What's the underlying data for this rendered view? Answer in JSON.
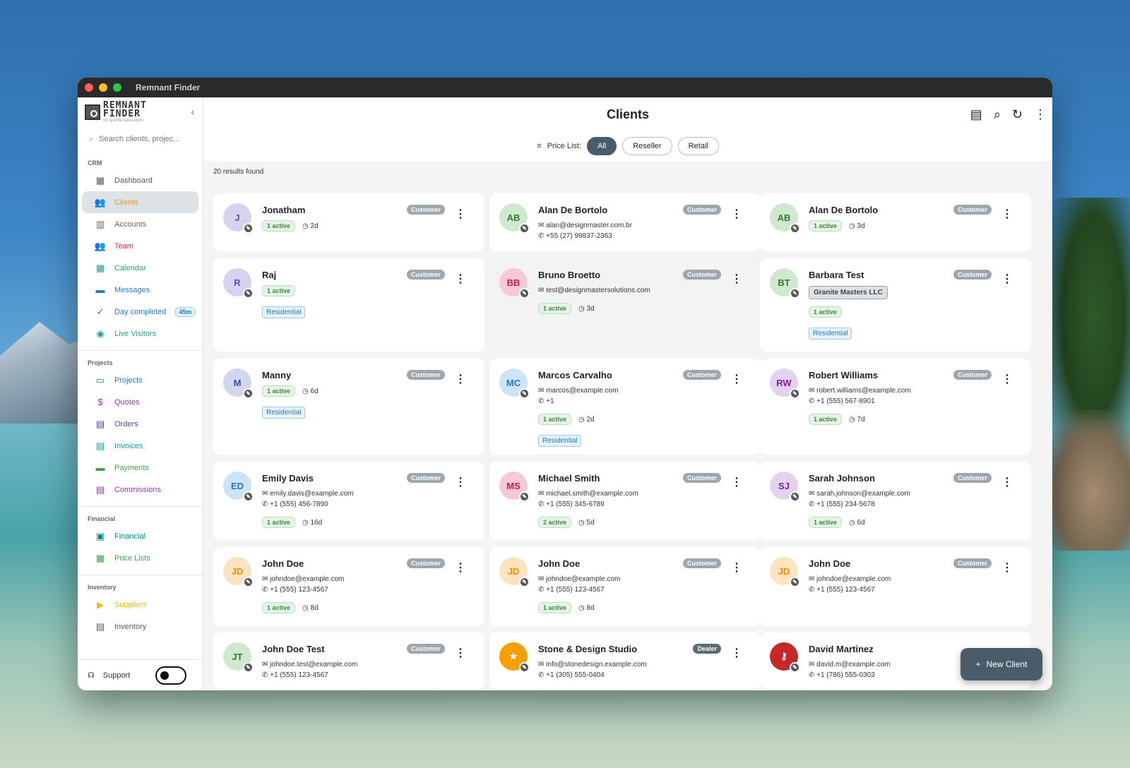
{
  "window": {
    "title": "Remnant Finder"
  },
  "sidebar": {
    "logo_line1": "REMNANT",
    "logo_line2": "FINDER",
    "logo_sub": "for granite fabricators",
    "search_placeholder": "Search clients, projec...",
    "sections": [
      {
        "label": "CRM",
        "items": [
          {
            "label": "Dashboard",
            "icon": "dashboard-icon",
            "color": "#4a5c6a",
            "active": false
          },
          {
            "label": "Clients",
            "icon": "people-icon",
            "color": "#f39c12",
            "active": true
          },
          {
            "label": "Accounts",
            "icon": "building-icon",
            "color": "#8d5a3b",
            "active": false
          },
          {
            "label": "Team",
            "icon": "team-icon",
            "color": "#e0245e",
            "active": false
          },
          {
            "label": "Calendar",
            "icon": "calendar-icon",
            "color": "#1aa38a",
            "active": false
          },
          {
            "label": "Messages",
            "icon": "message-icon",
            "color": "#1f7ac2",
            "active": false
          },
          {
            "label": "Day completed",
            "icon": "check-circle-icon",
            "color": "#1f7ac2",
            "active": false,
            "badge": "45m"
          },
          {
            "label": "Live Visitors",
            "icon": "visitors-icon",
            "color": "#1aa38a",
            "active": false
          }
        ]
      },
      {
        "label": "Projects",
        "items": [
          {
            "label": "Projects",
            "icon": "folder-icon",
            "color": "#1f7ac2"
          },
          {
            "label": "Quotes",
            "icon": "quote-icon",
            "color": "#9b30a8"
          },
          {
            "label": "Orders",
            "icon": "order-icon",
            "color": "#3949ab"
          },
          {
            "label": "Invoices",
            "icon": "invoice-icon",
            "color": "#00a3b4"
          },
          {
            "label": "Payments",
            "icon": "payment-icon",
            "color": "#43a047"
          },
          {
            "label": "Commissions",
            "icon": "commission-icon",
            "color": "#9b30a8"
          }
        ]
      },
      {
        "label": "Financial",
        "items": [
          {
            "label": "Financial",
            "icon": "financial-icon",
            "color": "#00897b"
          },
          {
            "label": "Price Lists",
            "icon": "pricelist-icon",
            "color": "#43a047"
          }
        ]
      },
      {
        "label": "Inventory",
        "items": [
          {
            "label": "Suppliers",
            "icon": "truck-icon",
            "color": "#f5b800"
          },
          {
            "label": "Inventory",
            "icon": "inventory-icon",
            "color": "#4a5c6a"
          }
        ]
      }
    ],
    "support_label": "Support"
  },
  "header": {
    "title": "Clients"
  },
  "filter": {
    "label": "Price List:",
    "chips": [
      "All",
      "Reseller",
      "Retail"
    ],
    "selected": "All"
  },
  "results": "20 results found",
  "fab_label": "New Client",
  "colors": {
    "primary": "#4a5c6a",
    "active_green": "#3a8a3e",
    "residential_blue": "#1f7ac2"
  },
  "cards": [
    {
      "name": "Jonatham",
      "initials": "J",
      "av_bg": "#d8d2ee",
      "av_fg": "#5b4fb3",
      "tag": "Customer",
      "active": "1 active",
      "time": "2d",
      "residential": false
    },
    {
      "name": "Alan De Bortolo",
      "initials": "AB",
      "av_bg": "#cfe8cf",
      "av_fg": "#2e7d32",
      "tag": "Customer",
      "email": "alan@designmaster.com.br",
      "phone": "+55 (27) 99837-2363"
    },
    {
      "name": "Alan De Bortolo",
      "initials": "AB",
      "av_bg": "#cfe8cf",
      "av_fg": "#2e7d32",
      "tag": "Customer",
      "active": "1 active",
      "time": "3d"
    },
    {
      "name": "Raj",
      "initials": "R",
      "av_bg": "#d8d2ee",
      "av_fg": "#5b4fb3",
      "tag": "Customer",
      "active": "1 active",
      "residential": "Residential"
    },
    {
      "name": "Bruno Broetto",
      "initials": "BB",
      "av_bg": "#f7c9d6",
      "av_fg": "#c2185b",
      "tag": "Customer",
      "email": "test@designmastersolutions.com",
      "active": "1 active",
      "time": "3d",
      "dim": true
    },
    {
      "name": "Barbara Test",
      "initials": "BT",
      "av_bg": "#cfe8cf",
      "av_fg": "#2e7d32",
      "tag": "Customer",
      "company": "Granite Masters LLC",
      "active": "1 active",
      "residential": "Residential"
    },
    {
      "name": "Manny",
      "initials": "M",
      "av_bg": "#d2d6ee",
      "av_fg": "#3949ab",
      "tag": "Customer",
      "active": "1 active",
      "time": "6d",
      "residential": "Residential"
    },
    {
      "name": "Marcos Carvalho",
      "initials": "MC",
      "av_bg": "#cde4f7",
      "av_fg": "#1f7ac2",
      "tag": "Customer",
      "email": "marcos@example.com",
      "phone": "+1",
      "active": "1 active",
      "time": "2d",
      "residential": "Residential"
    },
    {
      "name": "Robert Williams",
      "initials": "RW",
      "av_bg": "#e3d2ee",
      "av_fg": "#7b1fa2",
      "tag": "Customer",
      "email": "robert.williams@example.com",
      "phone": "+1 (555) 567-8901",
      "active": "1 active",
      "time": "7d"
    },
    {
      "name": "Emily Davis",
      "initials": "ED",
      "av_bg": "#cde4f7",
      "av_fg": "#1f7ac2",
      "tag": "Customer",
      "email": "emily.davis@example.com",
      "phone": "+1 (555) 456-7890",
      "active": "1 active",
      "time": "16d"
    },
    {
      "name": "Michael Smith",
      "initials": "MS",
      "av_bg": "#f7c9d6",
      "av_fg": "#c2185b",
      "tag": "Customer",
      "email": "michael.smith@example.com",
      "phone": "+1 (555) 345-6789",
      "active": "2 active",
      "time": "5d"
    },
    {
      "name": "Sarah Johnson",
      "initials": "SJ",
      "av_bg": "#e3d2ee",
      "av_fg": "#7b1fa2",
      "tag": "Customer",
      "email": "sarah.johnson@example.com",
      "phone": "+1 (555) 234-5678",
      "active": "1 active",
      "time": "6d"
    },
    {
      "name": "John Doe",
      "initials": "JD",
      "av_bg": "#fde3bf",
      "av_fg": "#ef8f00",
      "tag": "Customer",
      "email": "johndoe@example.com",
      "phone": "+1 (555) 123-4567",
      "active": "1 active",
      "time": "8d"
    },
    {
      "name": "John Doe",
      "initials": "JD",
      "av_bg": "#fde3bf",
      "av_fg": "#ef8f00",
      "tag": "Customer",
      "email": "johndoe@example.com",
      "phone": "+1 (555) 123-4567",
      "active": "1 active",
      "time": "8d"
    },
    {
      "name": "John Doe",
      "initials": "JD",
      "av_bg": "#fde3bf",
      "av_fg": "#ef8f00",
      "tag": "Customer",
      "email": "johndoe@example.com",
      "phone": "+1 (555) 123-4567"
    },
    {
      "name": "John Doe Test",
      "initials": "JT",
      "av_bg": "#cfe8cf",
      "av_fg": "#2e7d32",
      "tag": "Customer",
      "email": "johndoe.test@example.com",
      "phone": "+1 (555) 123-4567"
    },
    {
      "name": "Stone & Design Studio",
      "initials": "★",
      "av_bg": "#f5a000",
      "av_fg": "#ffffff",
      "tag": "Dealer",
      "email": "info@stonedesign.example.com",
      "phone": "+1 (305) 555-0404"
    },
    {
      "name": "David Martinez",
      "initials": "⚷",
      "av_bg": "#c62828",
      "av_fg": "#ffffff",
      "tag": "",
      "email": "david.m@example.com",
      "phone": "+1 (786) 555-0303"
    }
  ]
}
